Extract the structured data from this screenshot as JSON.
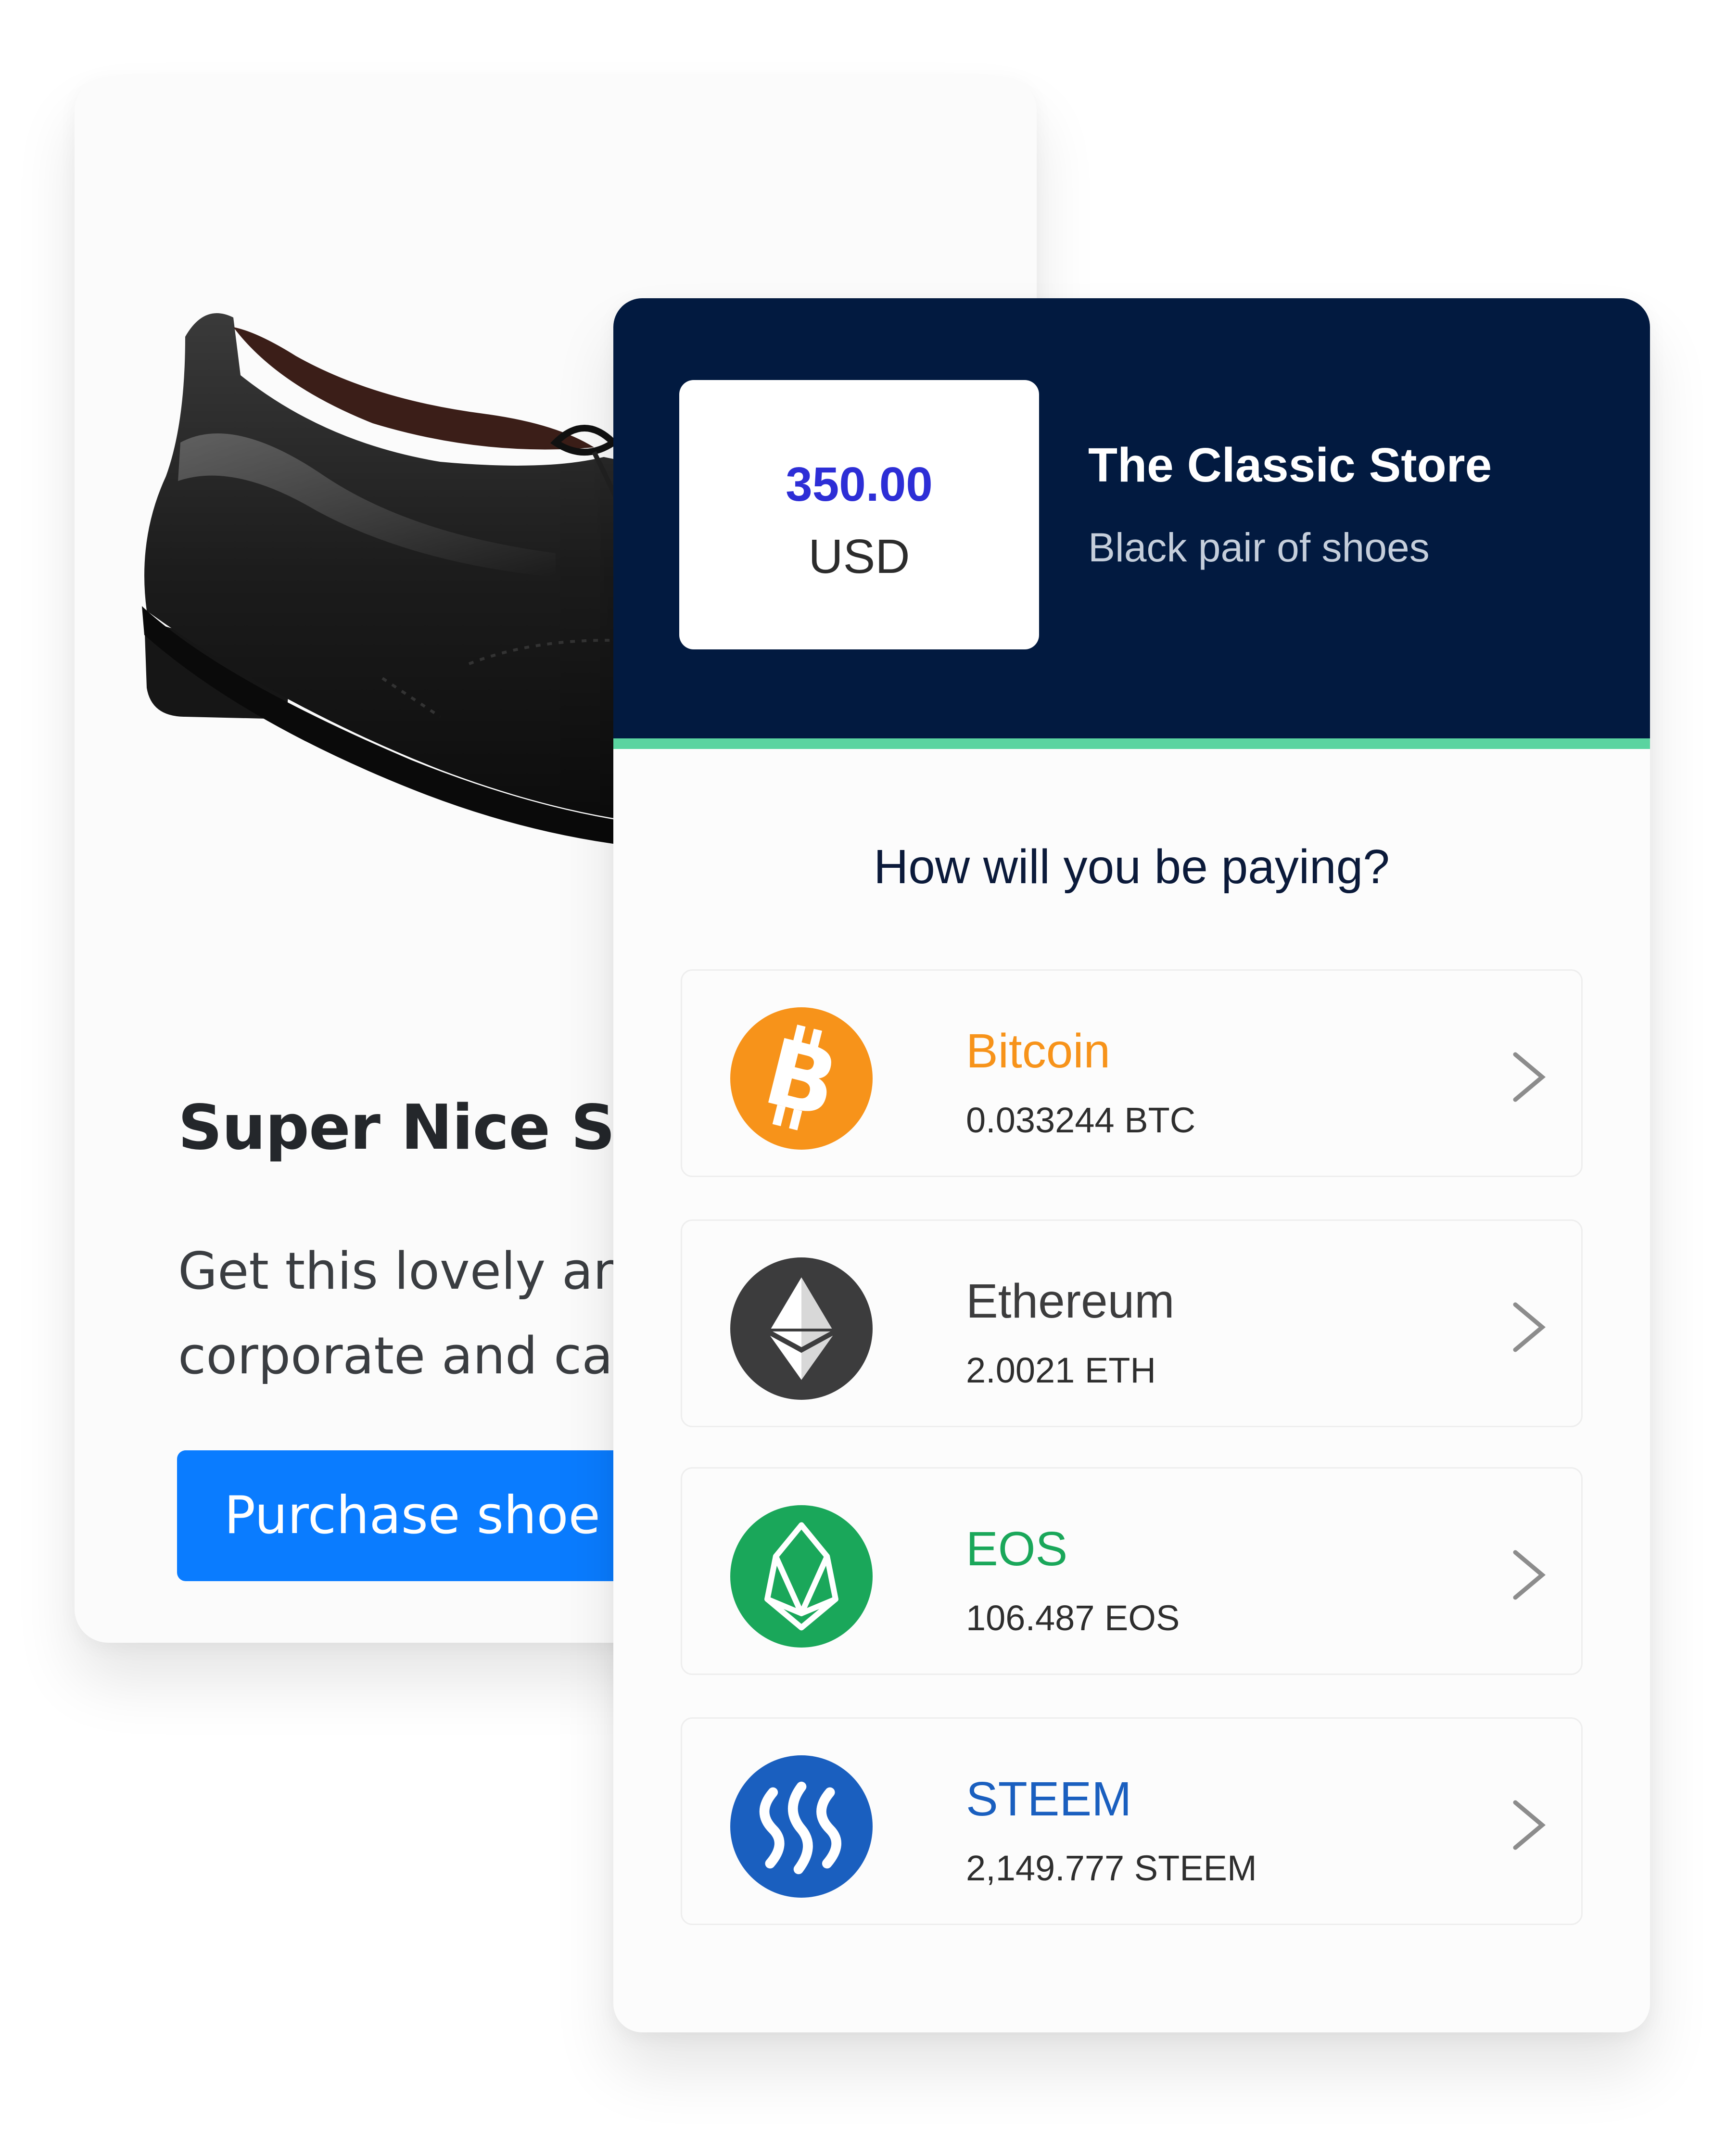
{
  "product": {
    "title": "Super Nice Shoe",
    "description_line1": "Get this lovely and stylish shoe for",
    "description_line2": "corporate and casual outings",
    "purchase_label": "Purchase shoe",
    "image": "black-leather-shoe-photo"
  },
  "checkout": {
    "price_amount": "350.00",
    "price_currency": "USD",
    "store_name": "The Classic Store",
    "item_name": "Black pair of shoes",
    "question": "How will you be paying?",
    "methods": [
      {
        "name": "Bitcoin",
        "amount": "0.033244 BTC",
        "color": "#f7931a",
        "icon": "bitcoin-icon"
      },
      {
        "name": "Ethereum",
        "amount": "2.0021 ETH",
        "color": "#3c3c3d",
        "icon": "ethereum-icon"
      },
      {
        "name": "EOS",
        "amount": "106.487 EOS",
        "color": "#1aa75a",
        "icon": "eos-icon"
      },
      {
        "name": "STEEM",
        "amount": "2,149.777 STEEM",
        "color": "#1a5fbf",
        "icon": "steem-icon"
      }
    ]
  },
  "colors": {
    "header_bg": "#021a40",
    "accent": "#5ad4a0",
    "price": "#2d2ed6",
    "button": "#0a7cff"
  }
}
